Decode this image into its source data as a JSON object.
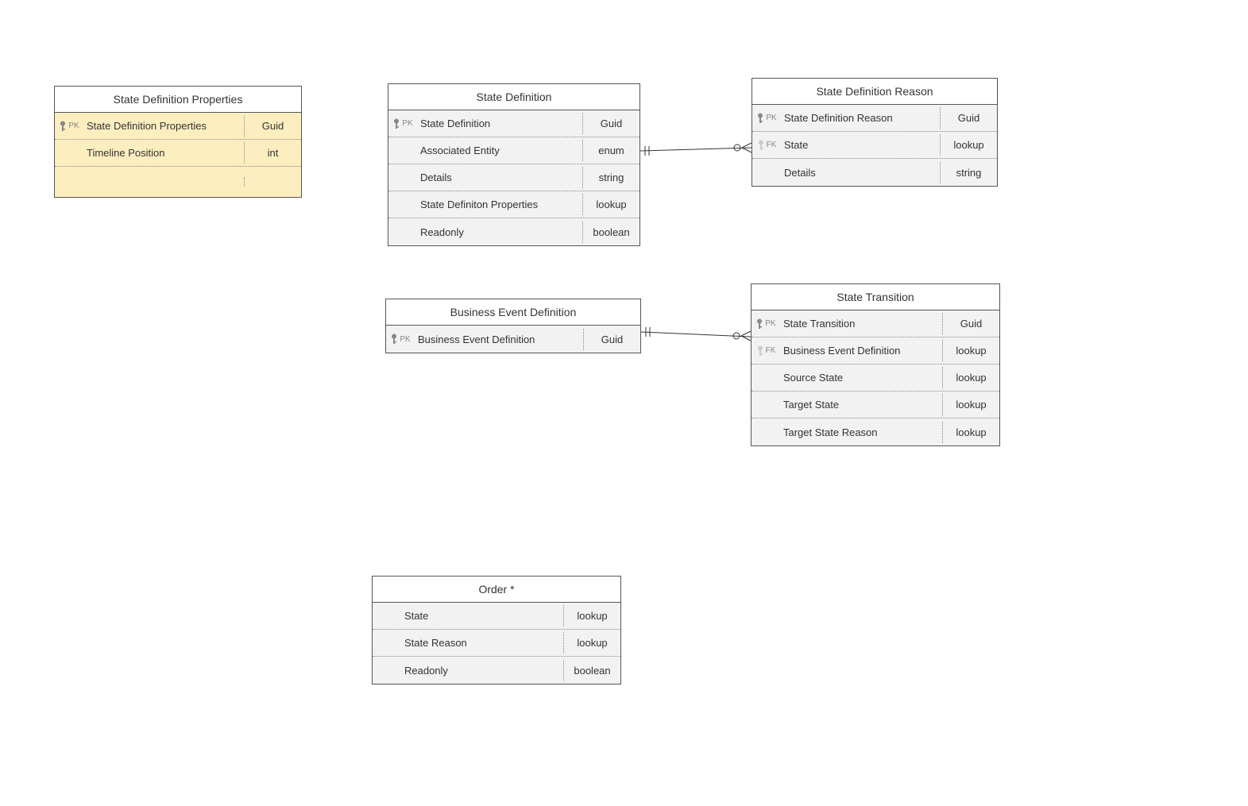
{
  "entities": {
    "stateDefProps": {
      "title": "State Definition Properties",
      "rows": [
        {
          "key": "PK",
          "name": "State Definition Properties",
          "type": "Guid"
        },
        {
          "key": "",
          "name": "Timeline Position",
          "type": "int"
        }
      ]
    },
    "stateDef": {
      "title": "State Definition",
      "rows": [
        {
          "key": "PK",
          "name": "State Definition",
          "type": "Guid"
        },
        {
          "key": "",
          "name": "Associated Entity",
          "type": "enum"
        },
        {
          "key": "",
          "name": "Details",
          "type": "string"
        },
        {
          "key": "",
          "name": "State Definiton Properties",
          "type": "lookup"
        },
        {
          "key": "",
          "name": "Readonly",
          "type": "boolean"
        }
      ]
    },
    "stateDefReason": {
      "title": "State Definition Reason",
      "rows": [
        {
          "key": "PK",
          "name": "State Definition Reason",
          "type": "Guid"
        },
        {
          "key": "FK",
          "name": "State",
          "type": "lookup"
        },
        {
          "key": "",
          "name": "Details",
          "type": "string"
        }
      ]
    },
    "bizEventDef": {
      "title": "Business Event Definition",
      "rows": [
        {
          "key": "PK",
          "name": "Business Event Definition",
          "type": "Guid"
        }
      ]
    },
    "stateTransition": {
      "title": "State Transition",
      "rows": [
        {
          "key": "PK",
          "name": "State Transition",
          "type": "Guid"
        },
        {
          "key": "FK",
          "name": "Business Event Definition",
          "type": "lookup"
        },
        {
          "key": "",
          "name": "Source State",
          "type": "lookup"
        },
        {
          "key": "",
          "name": "Target State",
          "type": "lookup"
        },
        {
          "key": "",
          "name": "Target State Reason",
          "type": "lookup"
        }
      ]
    },
    "order": {
      "title": "Order *",
      "rows": [
        {
          "key": "",
          "name": "State",
          "type": "lookup"
        },
        {
          "key": "",
          "name": "State Reason",
          "type": "lookup"
        },
        {
          "key": "",
          "name": "Readonly",
          "type": "boolean"
        }
      ]
    }
  },
  "chart_data": {
    "type": "erd",
    "entities": [
      "State Definition Properties",
      "State Definition",
      "State Definition Reason",
      "Business Event Definition",
      "State Transition",
      "Order *"
    ],
    "relationships": [
      {
        "from": "State Definition",
        "to": "State Definition Reason",
        "cardinality": "one-to-many"
      },
      {
        "from": "Business Event Definition",
        "to": "State Transition",
        "cardinality": "one-to-many"
      }
    ]
  }
}
